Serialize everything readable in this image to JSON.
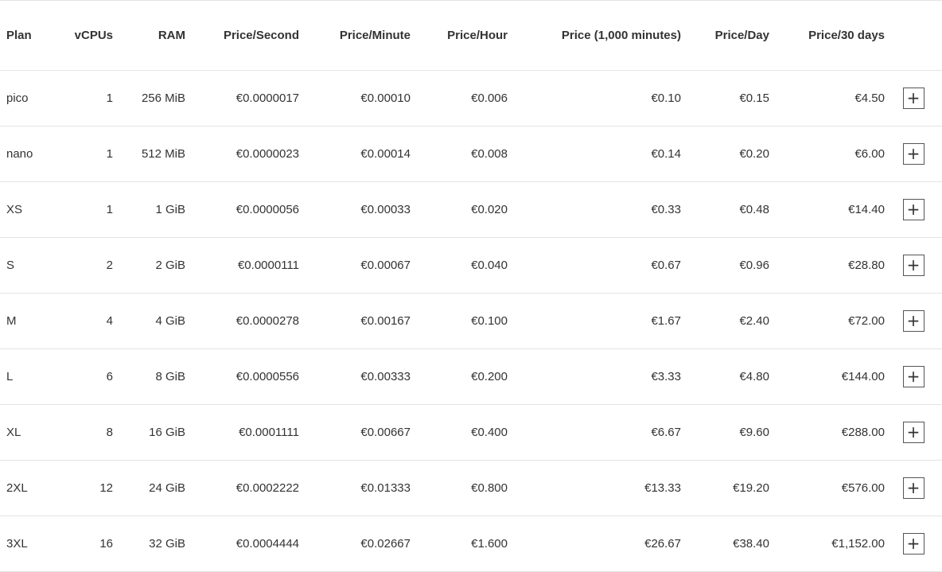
{
  "columns": [
    "Plan",
    "vCPUs",
    "RAM",
    "Price/Second",
    "Price/Minute",
    "Price/Hour",
    "Price (1,000 minutes)",
    "Price/Day",
    "Price/30 days"
  ],
  "add_icon": "plus-icon",
  "footnote_marker": "*",
  "accent_color": "#1e6fb8",
  "rows": [
    {
      "plan": "pico",
      "vcpus": "1",
      "vcpu_marker": "*",
      "ram": "256 MiB",
      "price_second": "€0.0000017",
      "price_minute": "€0.00010",
      "price_hour": "€0.006",
      "price_1000min": "€0.10",
      "price_day": "€0.15",
      "price_30days": "€4.50",
      "add": "+"
    },
    {
      "plan": "nano",
      "vcpus": "1",
      "vcpu_marker": "*",
      "ram": "512 MiB",
      "price_second": "€0.0000023",
      "price_minute": "€0.00014",
      "price_hour": "€0.008",
      "price_1000min": "€0.14",
      "price_day": "€0.20",
      "price_30days": "€6.00",
      "add": "+"
    },
    {
      "plan": "XS",
      "vcpus": "1",
      "vcpu_marker": "",
      "ram": "1 GiB",
      "price_second": "€0.0000056",
      "price_minute": "€0.00033",
      "price_hour": "€0.020",
      "price_1000min": "€0.33",
      "price_day": "€0.48",
      "price_30days": "€14.40",
      "add": "+"
    },
    {
      "plan": "S",
      "vcpus": "2",
      "vcpu_marker": "",
      "ram": "2 GiB",
      "price_second": "€0.0000111",
      "price_minute": "€0.00067",
      "price_hour": "€0.040",
      "price_1000min": "€0.67",
      "price_day": "€0.96",
      "price_30days": "€28.80",
      "add": "+"
    },
    {
      "plan": "M",
      "vcpus": "4",
      "vcpu_marker": "",
      "ram": "4 GiB",
      "price_second": "€0.0000278",
      "price_minute": "€0.00167",
      "price_hour": "€0.100",
      "price_1000min": "€1.67",
      "price_day": "€2.40",
      "price_30days": "€72.00",
      "add": "+"
    },
    {
      "plan": "L",
      "vcpus": "6",
      "vcpu_marker": "",
      "ram": "8 GiB",
      "price_second": "€0.0000556",
      "price_minute": "€0.00333",
      "price_hour": "€0.200",
      "price_1000min": "€3.33",
      "price_day": "€4.80",
      "price_30days": "€144.00",
      "add": "+"
    },
    {
      "plan": "XL",
      "vcpus": "8",
      "vcpu_marker": "",
      "ram": "16 GiB",
      "price_second": "€0.0001111",
      "price_minute": "€0.00667",
      "price_hour": "€0.400",
      "price_1000min": "€6.67",
      "price_day": "€9.60",
      "price_30days": "€288.00",
      "add": "+"
    },
    {
      "plan": "2XL",
      "vcpus": "12",
      "vcpu_marker": "",
      "ram": "24 GiB",
      "price_second": "€0.0002222",
      "price_minute": "€0.01333",
      "price_hour": "€0.800",
      "price_1000min": "€13.33",
      "price_day": "€19.20",
      "price_30days": "€576.00",
      "add": "+"
    },
    {
      "plan": "3XL",
      "vcpus": "16",
      "vcpu_marker": "",
      "ram": "32 GiB",
      "price_second": "€0.0004444",
      "price_minute": "€0.02667",
      "price_hour": "€1.600",
      "price_1000min": "€26.67",
      "price_day": "€38.40",
      "price_30days": "€1,152.00",
      "add": "+"
    }
  ]
}
